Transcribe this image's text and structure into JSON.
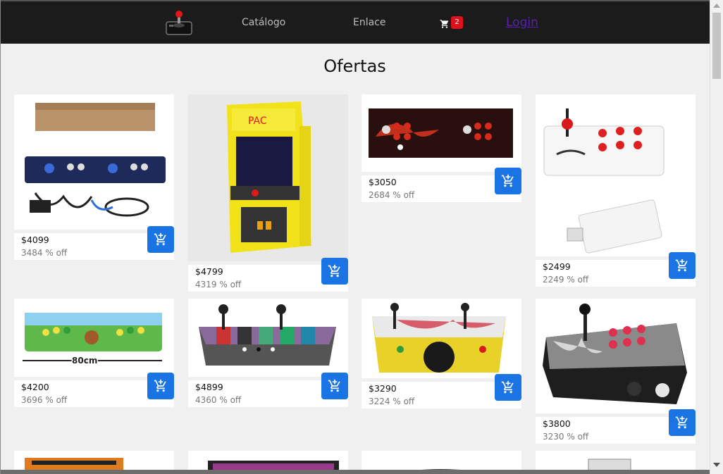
{
  "nav": {
    "links": [
      "Catálogo",
      "Enlace"
    ],
    "cart_count": "2",
    "login_label": "Login"
  },
  "page": {
    "title": "Ofertas"
  },
  "products": [
    {
      "price": "$4099",
      "discount": "3484 % off",
      "image": "arcade-console-box-icon"
    },
    {
      "price": "$4799",
      "discount": "4319 % off",
      "image": "pacman-mini-cabinet-icon"
    },
    {
      "price": "$3050",
      "discount": "2684 % off",
      "image": "arcade-panel-red-icon"
    },
    {
      "price": "$2499",
      "discount": "2249 % off",
      "image": "arcade-stick-size-icon"
    },
    {
      "price": "$4200",
      "discount": "3696 % off",
      "image": "mario-arcade-panel-icon"
    },
    {
      "price": "$4899",
      "discount": "4360 % off",
      "image": "characters-arcade-box-icon"
    },
    {
      "price": "$3290",
      "discount": "3224 % off",
      "image": "yellow-arcade-box-icon"
    },
    {
      "price": "$3800",
      "discount": "3230 % off",
      "image": "dark-arcade-stick-icon"
    }
  ],
  "colors": {
    "navbar": "#1b1b1b",
    "cart_button": "#1b74e4",
    "badge": "#e0101a",
    "login": "#5b1fb5"
  }
}
